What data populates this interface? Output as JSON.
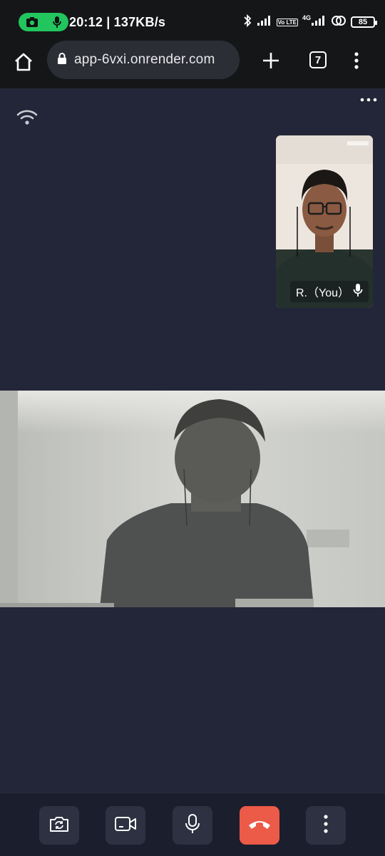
{
  "status_bar": {
    "time_speed": "20:12 | 137KB/s",
    "network_type": "4G",
    "volte_label": "Vo LTE",
    "battery_level": "85",
    "icons": [
      "camera-icon",
      "mic-icon",
      "bluetooth-icon",
      "signal-icon",
      "hotspot-icon",
      "battery-icon"
    ]
  },
  "browser": {
    "url": "app-6vxi.onrender.com",
    "tab_count": "7",
    "icons": [
      "home-icon",
      "lock-icon",
      "plus-icon",
      "tabs-icon",
      "more-vertical-icon"
    ]
  },
  "call": {
    "self_name": "R.（You）",
    "connection_icon": "wifi-icon",
    "controls": [
      {
        "name": "switch-camera",
        "icon": "camera-flip-icon"
      },
      {
        "name": "video-toggle",
        "icon": "video-camera-icon"
      },
      {
        "name": "mic-toggle",
        "icon": "mic-icon"
      },
      {
        "name": "end-call",
        "icon": "phone-hangup-icon",
        "color": "#ec5a48"
      },
      {
        "name": "more-options",
        "icon": "more-vertical-icon"
      }
    ]
  },
  "colors": {
    "background": "#232638",
    "control_bar": "#1b1e2c",
    "control_button": "#2d3142",
    "end_call": "#ec5a48",
    "recording_pill": "#22c55e"
  }
}
